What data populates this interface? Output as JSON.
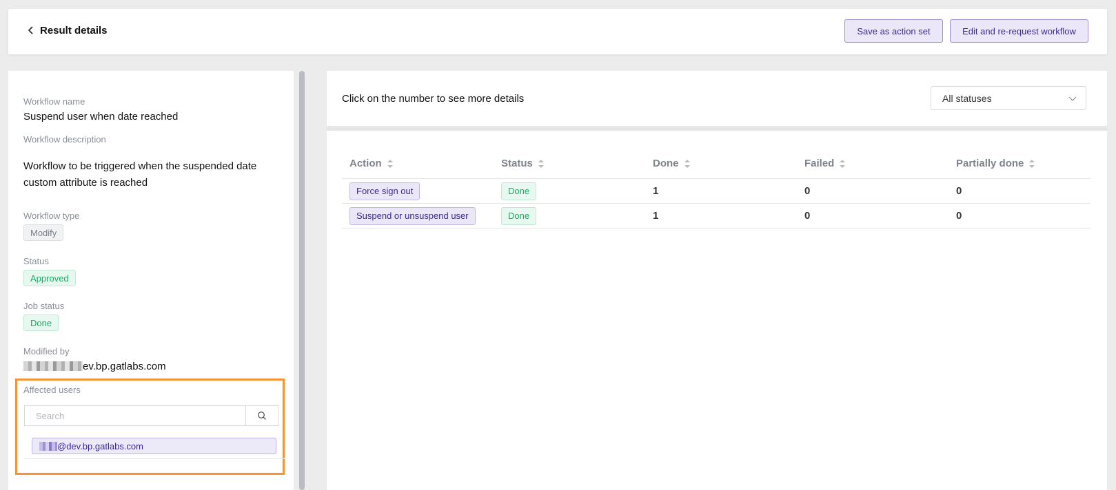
{
  "header": {
    "title": "Result details",
    "save_action_set_label": "Save as action set",
    "edit_rerequest_label": "Edit and re-request workflow"
  },
  "details": {
    "workflow_name_label": "Workflow name",
    "workflow_name": "Suspend user when date reached",
    "workflow_description_label": "Workflow description",
    "workflow_description": "Workflow to be triggered when the suspended date custom attribute is reached",
    "workflow_type_label": "Workflow type",
    "workflow_type": "Modify",
    "status_label": "Status",
    "status": "Approved",
    "job_status_label": "Job status",
    "job_status": "Done",
    "modified_by_label": "Modified by",
    "modified_by_suffix": "ev.bp.gatlabs.com",
    "affected_users_label": "Affected users",
    "search_placeholder": "Search",
    "affected_user_suffix": "@dev.bp.gatlabs.com"
  },
  "results": {
    "hint": "Click on the number to see more details",
    "status_filter": "All statuses",
    "columns": [
      "Action",
      "Status",
      "Done",
      "Failed",
      "Partially done"
    ],
    "rows": [
      {
        "action": "Force sign out",
        "status": "Done",
        "done": "1",
        "failed": "0",
        "partially_done": "0"
      },
      {
        "action": "Suspend or unsuspend user",
        "status": "Done",
        "done": "1",
        "failed": "0",
        "partially_done": "0"
      }
    ]
  },
  "colors": {
    "accent": "#3b2a96",
    "success": "#1aab62",
    "highlight": "#f39536"
  },
  "icons": [
    "chevron-left-icon",
    "search-icon",
    "chevron-down-icon",
    "sort-icon"
  ]
}
